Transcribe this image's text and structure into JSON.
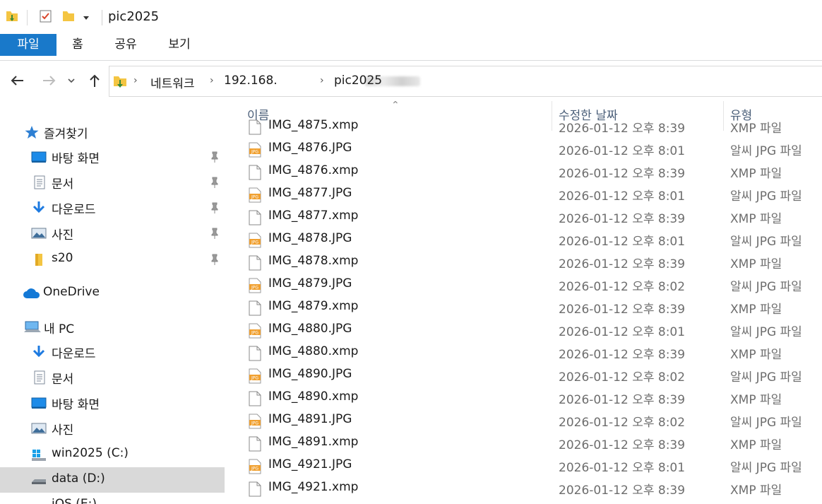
{
  "window": {
    "title": "pic2025"
  },
  "ribbon": {
    "tabs": [
      {
        "label": "파일"
      },
      {
        "label": "홈"
      },
      {
        "label": "공유"
      },
      {
        "label": "보기"
      }
    ]
  },
  "address": {
    "crumbs": [
      {
        "label": "네트워크"
      },
      {
        "label": "192.168."
      },
      {
        "label": "pic2025"
      }
    ]
  },
  "nav": {
    "items": [
      {
        "label": "즐겨찾기",
        "icon": "star-icon"
      },
      {
        "label": "바탕 화면",
        "icon": "desktop-icon",
        "pinned": true
      },
      {
        "label": "문서",
        "icon": "document-icon",
        "pinned": true
      },
      {
        "label": "다운로드",
        "icon": "download-icon",
        "pinned": true
      },
      {
        "label": "사진",
        "icon": "pictures-icon",
        "pinned": true
      },
      {
        "label": "s20",
        "icon": "folder-icon",
        "pinned": true
      },
      {
        "label": "OneDrive",
        "icon": "cloud-icon"
      },
      {
        "label": "내 PC",
        "icon": "computer-icon"
      },
      {
        "label": "다운로드",
        "icon": "download-icon"
      },
      {
        "label": "문서",
        "icon": "document-icon"
      },
      {
        "label": "바탕 화면",
        "icon": "desktop-icon"
      },
      {
        "label": "사진",
        "icon": "pictures-icon"
      },
      {
        "label": "win2025 (C:)",
        "icon": "windows-drive-icon"
      },
      {
        "label": "data (D:)",
        "icon": "drive-icon",
        "selected": true
      },
      {
        "label": "iOS (E:)",
        "icon": "drive-icon"
      }
    ]
  },
  "list": {
    "columns": {
      "name": "이름",
      "date": "수정한 날짜",
      "type": "유형"
    },
    "files": [
      {
        "name": "IMG_4875.xmp",
        "date": "2026-01-12 오후 8:39",
        "type": "XMP 파일",
        "kind": "xmp"
      },
      {
        "name": "IMG_4876.JPG",
        "date": "2026-01-12 오후 8:01",
        "type": "알씨 JPG 파일",
        "kind": "jpg"
      },
      {
        "name": "IMG_4876.xmp",
        "date": "2026-01-12 오후 8:39",
        "type": "XMP 파일",
        "kind": "xmp"
      },
      {
        "name": "IMG_4877.JPG",
        "date": "2026-01-12 오후 8:01",
        "type": "알씨 JPG 파일",
        "kind": "jpg"
      },
      {
        "name": "IMG_4877.xmp",
        "date": "2026-01-12 오후 8:39",
        "type": "XMP 파일",
        "kind": "xmp"
      },
      {
        "name": "IMG_4878.JPG",
        "date": "2026-01-12 오후 8:01",
        "type": "알씨 JPG 파일",
        "kind": "jpg"
      },
      {
        "name": "IMG_4878.xmp",
        "date": "2026-01-12 오후 8:39",
        "type": "XMP 파일",
        "kind": "xmp"
      },
      {
        "name": "IMG_4879.JPG",
        "date": "2026-01-12 오후 8:02",
        "type": "알씨 JPG 파일",
        "kind": "jpg"
      },
      {
        "name": "IMG_4879.xmp",
        "date": "2026-01-12 오후 8:39",
        "type": "XMP 파일",
        "kind": "xmp"
      },
      {
        "name": "IMG_4880.JPG",
        "date": "2026-01-12 오후 8:01",
        "type": "알씨 JPG 파일",
        "kind": "jpg"
      },
      {
        "name": "IMG_4880.xmp",
        "date": "2026-01-12 오후 8:39",
        "type": "XMP 파일",
        "kind": "xmp"
      },
      {
        "name": "IMG_4890.JPG",
        "date": "2026-01-12 오후 8:02",
        "type": "알씨 JPG 파일",
        "kind": "jpg"
      },
      {
        "name": "IMG_4890.xmp",
        "date": "2026-01-12 오후 8:39",
        "type": "XMP 파일",
        "kind": "xmp"
      },
      {
        "name": "IMG_4891.JPG",
        "date": "2026-01-12 오후 8:02",
        "type": "알씨 JPG 파일",
        "kind": "jpg"
      },
      {
        "name": "IMG_4891.xmp",
        "date": "2026-01-12 오후 8:39",
        "type": "XMP 파일",
        "kind": "xmp"
      },
      {
        "name": "IMG_4921.JPG",
        "date": "2026-01-12 오후 8:01",
        "type": "알씨 JPG 파일",
        "kind": "jpg"
      },
      {
        "name": "IMG_4921.xmp",
        "date": "2026-01-12 오후 8:39",
        "type": "XMP 파일",
        "kind": "xmp"
      }
    ]
  },
  "colors": {
    "accent": "#1979ca",
    "selection": "#d9d9d9",
    "header_text": "#4c607a",
    "jpg_badge": "#f0a030",
    "folder": "#f4c542"
  }
}
